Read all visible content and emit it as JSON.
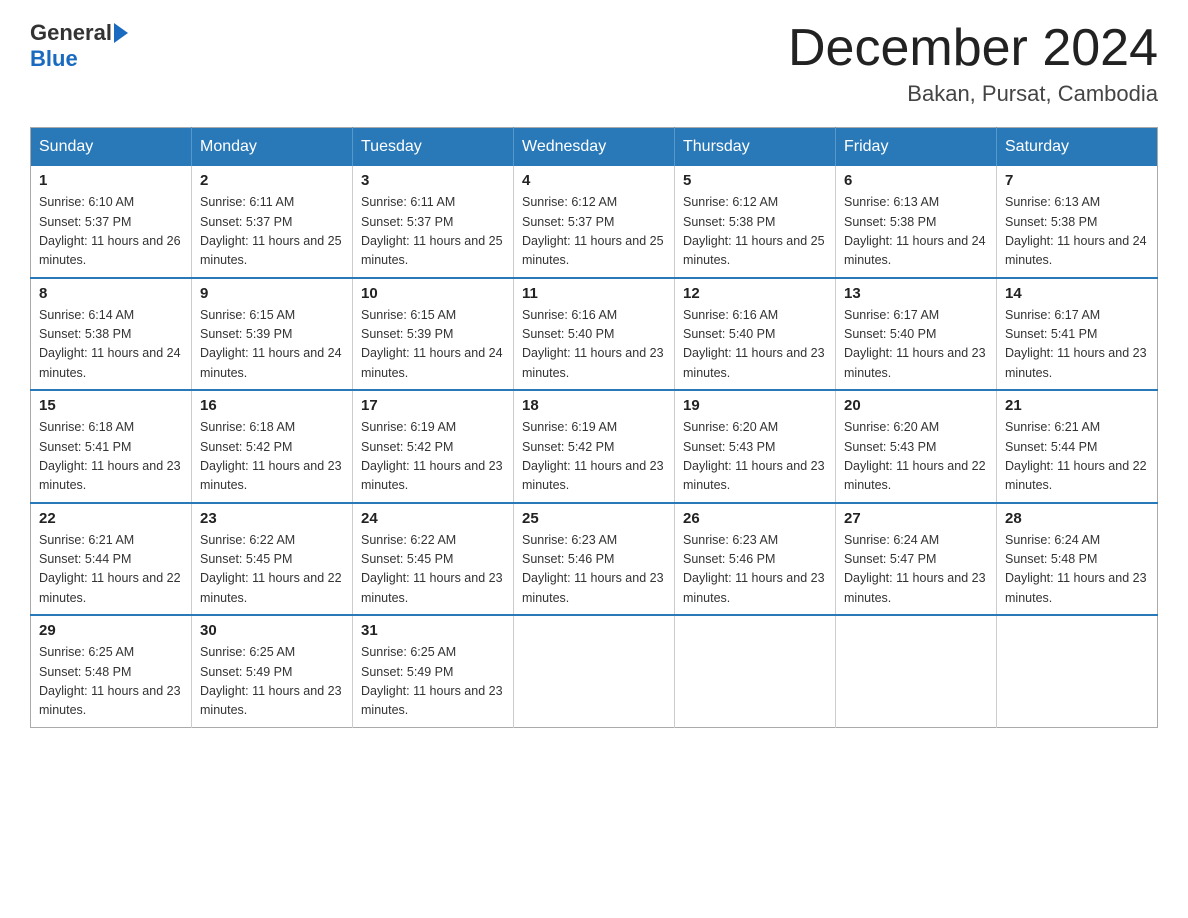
{
  "header": {
    "logo_general": "General",
    "logo_blue": "Blue",
    "month_title": "December 2024",
    "subtitle": "Bakan, Pursat, Cambodia"
  },
  "calendar": {
    "days_of_week": [
      "Sunday",
      "Monday",
      "Tuesday",
      "Wednesday",
      "Thursday",
      "Friday",
      "Saturday"
    ],
    "weeks": [
      [
        {
          "day": "1",
          "sunrise": "6:10 AM",
          "sunset": "5:37 PM",
          "daylight": "11 hours and 26 minutes."
        },
        {
          "day": "2",
          "sunrise": "6:11 AM",
          "sunset": "5:37 PM",
          "daylight": "11 hours and 25 minutes."
        },
        {
          "day": "3",
          "sunrise": "6:11 AM",
          "sunset": "5:37 PM",
          "daylight": "11 hours and 25 minutes."
        },
        {
          "day": "4",
          "sunrise": "6:12 AM",
          "sunset": "5:37 PM",
          "daylight": "11 hours and 25 minutes."
        },
        {
          "day": "5",
          "sunrise": "6:12 AM",
          "sunset": "5:38 PM",
          "daylight": "11 hours and 25 minutes."
        },
        {
          "day": "6",
          "sunrise": "6:13 AM",
          "sunset": "5:38 PM",
          "daylight": "11 hours and 24 minutes."
        },
        {
          "day": "7",
          "sunrise": "6:13 AM",
          "sunset": "5:38 PM",
          "daylight": "11 hours and 24 minutes."
        }
      ],
      [
        {
          "day": "8",
          "sunrise": "6:14 AM",
          "sunset": "5:38 PM",
          "daylight": "11 hours and 24 minutes."
        },
        {
          "day": "9",
          "sunrise": "6:15 AM",
          "sunset": "5:39 PM",
          "daylight": "11 hours and 24 minutes."
        },
        {
          "day": "10",
          "sunrise": "6:15 AM",
          "sunset": "5:39 PM",
          "daylight": "11 hours and 24 minutes."
        },
        {
          "day": "11",
          "sunrise": "6:16 AM",
          "sunset": "5:40 PM",
          "daylight": "11 hours and 23 minutes."
        },
        {
          "day": "12",
          "sunrise": "6:16 AM",
          "sunset": "5:40 PM",
          "daylight": "11 hours and 23 minutes."
        },
        {
          "day": "13",
          "sunrise": "6:17 AM",
          "sunset": "5:40 PM",
          "daylight": "11 hours and 23 minutes."
        },
        {
          "day": "14",
          "sunrise": "6:17 AM",
          "sunset": "5:41 PM",
          "daylight": "11 hours and 23 minutes."
        }
      ],
      [
        {
          "day": "15",
          "sunrise": "6:18 AM",
          "sunset": "5:41 PM",
          "daylight": "11 hours and 23 minutes."
        },
        {
          "day": "16",
          "sunrise": "6:18 AM",
          "sunset": "5:42 PM",
          "daylight": "11 hours and 23 minutes."
        },
        {
          "day": "17",
          "sunrise": "6:19 AM",
          "sunset": "5:42 PM",
          "daylight": "11 hours and 23 minutes."
        },
        {
          "day": "18",
          "sunrise": "6:19 AM",
          "sunset": "5:42 PM",
          "daylight": "11 hours and 23 minutes."
        },
        {
          "day": "19",
          "sunrise": "6:20 AM",
          "sunset": "5:43 PM",
          "daylight": "11 hours and 23 minutes."
        },
        {
          "day": "20",
          "sunrise": "6:20 AM",
          "sunset": "5:43 PM",
          "daylight": "11 hours and 22 minutes."
        },
        {
          "day": "21",
          "sunrise": "6:21 AM",
          "sunset": "5:44 PM",
          "daylight": "11 hours and 22 minutes."
        }
      ],
      [
        {
          "day": "22",
          "sunrise": "6:21 AM",
          "sunset": "5:44 PM",
          "daylight": "11 hours and 22 minutes."
        },
        {
          "day": "23",
          "sunrise": "6:22 AM",
          "sunset": "5:45 PM",
          "daylight": "11 hours and 22 minutes."
        },
        {
          "day": "24",
          "sunrise": "6:22 AM",
          "sunset": "5:45 PM",
          "daylight": "11 hours and 23 minutes."
        },
        {
          "day": "25",
          "sunrise": "6:23 AM",
          "sunset": "5:46 PM",
          "daylight": "11 hours and 23 minutes."
        },
        {
          "day": "26",
          "sunrise": "6:23 AM",
          "sunset": "5:46 PM",
          "daylight": "11 hours and 23 minutes."
        },
        {
          "day": "27",
          "sunrise": "6:24 AM",
          "sunset": "5:47 PM",
          "daylight": "11 hours and 23 minutes."
        },
        {
          "day": "28",
          "sunrise": "6:24 AM",
          "sunset": "5:48 PM",
          "daylight": "11 hours and 23 minutes."
        }
      ],
      [
        {
          "day": "29",
          "sunrise": "6:25 AM",
          "sunset": "5:48 PM",
          "daylight": "11 hours and 23 minutes."
        },
        {
          "day": "30",
          "sunrise": "6:25 AM",
          "sunset": "5:49 PM",
          "daylight": "11 hours and 23 minutes."
        },
        {
          "day": "31",
          "sunrise": "6:25 AM",
          "sunset": "5:49 PM",
          "daylight": "11 hours and 23 minutes."
        },
        null,
        null,
        null,
        null
      ]
    ]
  }
}
